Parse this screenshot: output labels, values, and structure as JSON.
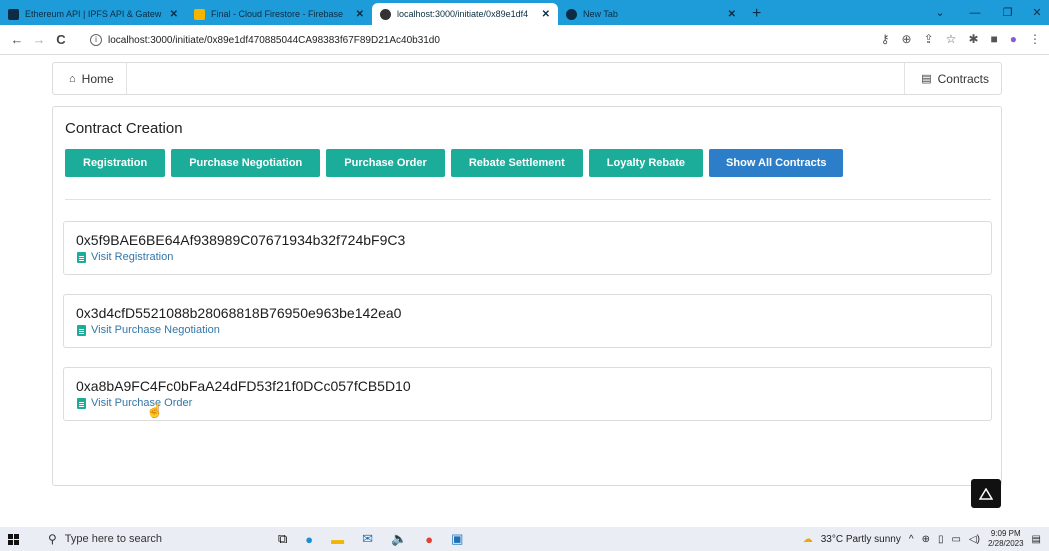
{
  "browser": {
    "tabs": [
      {
        "label": "Ethereum API | IPFS API & Gatew",
        "icon": "grid-icon",
        "active": false
      },
      {
        "label": "Final - Cloud Firestore - Firebase",
        "icon": "firebase-icon",
        "active": false
      },
      {
        "label": "localhost:3000/initiate/0x89e1df4",
        "icon": "globe-icon",
        "active": true
      },
      {
        "label": "New Tab",
        "icon": "chrome-icon",
        "active": false
      }
    ],
    "url": "localhost:3000/initiate/0x89e1df470885044CA98383f67F89D21Ac40b31d0"
  },
  "navbar": {
    "home_label": "Home",
    "contracts_label": "Contracts"
  },
  "contract_creation": {
    "title": "Contract Creation",
    "buttons": [
      {
        "label": "Registration"
      },
      {
        "label": "Purchase Negotiation"
      },
      {
        "label": "Purchase Order"
      },
      {
        "label": "Rebate Settlement"
      },
      {
        "label": "Loyalty Rebate"
      },
      {
        "label": "Show All Contracts"
      }
    ],
    "contracts": [
      {
        "address": "0x5f9BAE6BE64Af938989C07671934b32f724bF9C3",
        "link": "Visit Registration"
      },
      {
        "address": "0x3d4cfD5521088b28068818B76950e963be142ea0",
        "link": "Visit Purchase Negotiation"
      },
      {
        "address": "0xa8bA9FC4Fc0bFaA24dFD53f21f0DCc057fCB5D10",
        "link": "Visit Purchase Order"
      }
    ]
  },
  "taskbar": {
    "search_placeholder": "Type here to search",
    "weather": "33°C  Partly sunny",
    "time": "9:09 PM",
    "date": "2/28/2023"
  },
  "colors": {
    "teal": "#1bac9a",
    "blue": "#2d7ec9",
    "chrome_blue": "#1e9cda"
  }
}
